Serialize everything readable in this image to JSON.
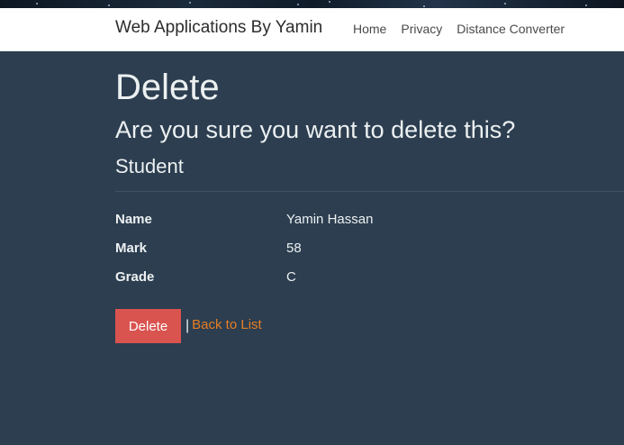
{
  "navbar": {
    "brand": "Web Applications By Yamin",
    "links": [
      {
        "label": "Home"
      },
      {
        "label": "Privacy"
      },
      {
        "label": "Distance Converter"
      }
    ]
  },
  "page": {
    "title": "Delete",
    "confirm_text": "Are you sure you want to delete this?",
    "entity": "Student"
  },
  "details": [
    {
      "label": "Name",
      "value": "Yamin Hassan"
    },
    {
      "label": "Mark",
      "value": "58"
    },
    {
      "label": "Grade",
      "value": "C"
    }
  ],
  "actions": {
    "delete_label": "Delete",
    "separator": "|",
    "back_label": "Back to List"
  },
  "colors": {
    "background": "#2c3e50",
    "navbar": "#ffffff",
    "delete_button": "#d9534f",
    "link": "#e67e22",
    "text": "#ecf0f1"
  }
}
